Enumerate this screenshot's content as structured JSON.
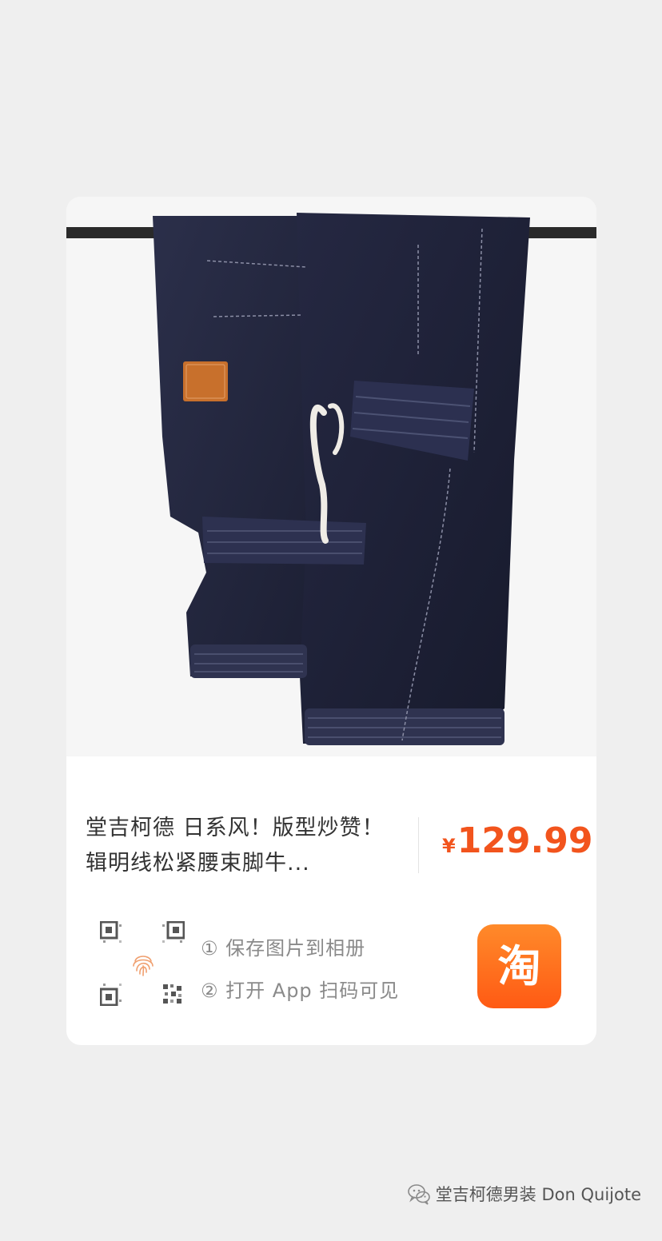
{
  "product": {
    "title": "堂吉柯德 日系风！版型炒赞！辑明线松紧腰束脚牛...",
    "currency_symbol": "¥",
    "price": "129.99",
    "accent_color": "#f2541d"
  },
  "instructions": {
    "step1": "① 保存图片到相册",
    "step2": "② 打开 App 扫码可见"
  },
  "app_badge": {
    "char": "淘",
    "color": "#ff6a1a",
    "icon": "taobao-app-icon"
  },
  "footer": {
    "account_name": "堂吉柯德男装 Don Quijote",
    "icon": "wechat-icon"
  }
}
